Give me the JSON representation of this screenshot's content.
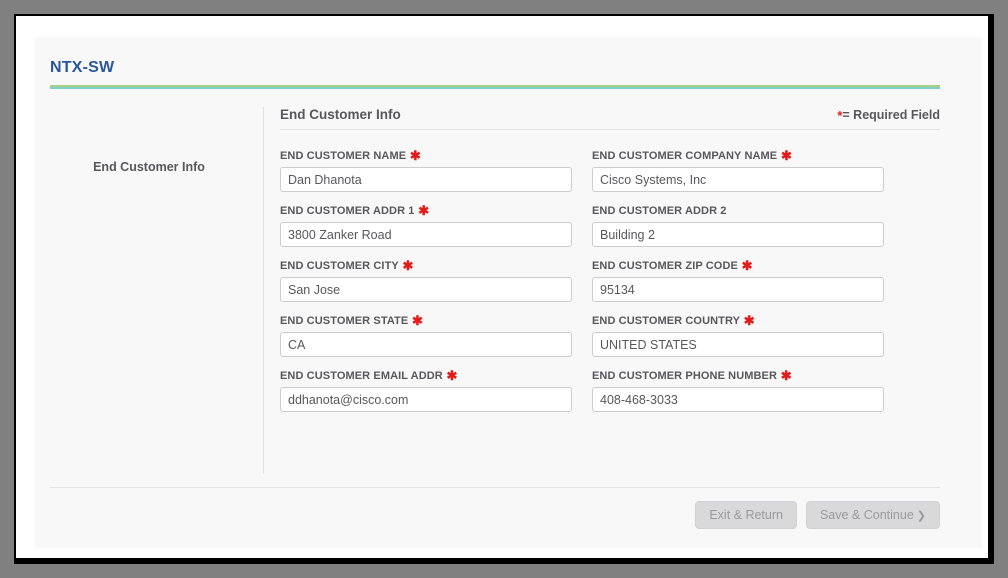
{
  "window": {
    "title": "NTX-SW"
  },
  "sidebar": {
    "items": [
      {
        "label": "End Customer Info",
        "name": "sidebar-item-end-customer-info"
      }
    ]
  },
  "section": {
    "title": "End Customer Info",
    "required_note": "= Required Field",
    "required_marker": "*"
  },
  "form": {
    "fields": [
      {
        "label": "END CUSTOMER NAME",
        "required": true,
        "value": "Dan Dhanota",
        "placeholder": "",
        "name": "end-customer-name-input"
      },
      {
        "label": "END CUSTOMER COMPANY NAME",
        "required": true,
        "value": "Cisco Systems, Inc",
        "placeholder": "",
        "name": "end-customer-company-name-input"
      },
      {
        "label": "END CUSTOMER ADDR 1",
        "required": true,
        "value": "3800 Zanker Road",
        "placeholder": "",
        "name": "end-customer-addr-1-input"
      },
      {
        "label": "END CUSTOMER ADDR 2",
        "required": false,
        "value": "Building 2",
        "placeholder": "",
        "name": "end-customer-addr-2-input"
      },
      {
        "label": "END CUSTOMER CITY",
        "required": true,
        "value": "San Jose",
        "placeholder": "",
        "name": "end-customer-city-input"
      },
      {
        "label": "END CUSTOMER ZIP CODE",
        "required": true,
        "value": "95134",
        "placeholder": "",
        "name": "end-customer-zip-code-input"
      },
      {
        "label": "END CUSTOMER STATE",
        "required": true,
        "value": "CA",
        "placeholder": "",
        "name": "end-customer-state-input"
      },
      {
        "label": "END CUSTOMER COUNTRY",
        "required": true,
        "value": "UNITED STATES",
        "placeholder": "",
        "name": "end-customer-country-input"
      },
      {
        "label": "END CUSTOMER EMAIL ADDR",
        "required": true,
        "value": "ddhanota@cisco.com",
        "placeholder": "",
        "name": "end-customer-email-addr-input"
      },
      {
        "label": "END CUSTOMER PHONE NUMBER",
        "required": true,
        "value": "408-468-3033",
        "placeholder": "",
        "name": "end-customer-phone-number-input"
      }
    ]
  },
  "footer": {
    "exit_label": "Exit & Return",
    "save_label": "Save & Continue",
    "save_chevron": "❯"
  },
  "colors": {
    "title": "#2a5699",
    "rule_green": "#a7cf86",
    "rule_teal": "#7fd0c8",
    "required_star": "#e21b1b",
    "text": "#58585b",
    "input_border": "#cdcdcd",
    "button_bg": "#d9d9dc",
    "button_text": "#9a9a9e",
    "frame": "#808080"
  }
}
